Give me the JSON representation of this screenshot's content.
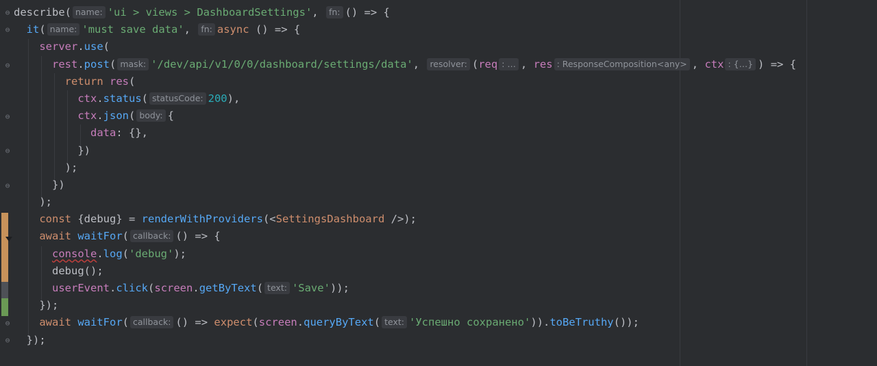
{
  "editor": {
    "lines": [
      [
        {
          "t": "describe",
          "c": ""
        },
        {
          "t": "(",
          "c": ""
        },
        {
          "h": "name:"
        },
        {
          "t": "'ui > views > DashboardSettings'",
          "c": "str"
        },
        {
          "t": ", ",
          "c": ""
        },
        {
          "h": "fn:"
        },
        {
          "t": "() => {",
          "c": ""
        }
      ],
      [
        {
          "t": "  "
        },
        {
          "t": "it",
          "c": "fn"
        },
        {
          "t": "(",
          "c": ""
        },
        {
          "h": "name:"
        },
        {
          "t": "'must save data'",
          "c": "str"
        },
        {
          "t": ", ",
          "c": ""
        },
        {
          "h": "fn:"
        },
        {
          "t": "async",
          "c": "kw"
        },
        {
          "t": " () => {",
          "c": ""
        }
      ],
      [
        {
          "t": "    "
        },
        {
          "t": "server",
          "c": "prop"
        },
        {
          "t": "."
        },
        {
          "t": "use",
          "c": "fn"
        },
        {
          "t": "("
        }
      ],
      [
        {
          "t": "      "
        },
        {
          "t": "rest",
          "c": "prop"
        },
        {
          "t": "."
        },
        {
          "t": "post",
          "c": "fn"
        },
        {
          "t": "("
        },
        {
          "h": "mask:"
        },
        {
          "t": "'/dev/api/v1/0/0/dashboard/settings/data'",
          "c": "str"
        },
        {
          "t": ", "
        },
        {
          "h": "resolver:"
        },
        {
          "t": "("
        },
        {
          "t": "req",
          "c": "prop"
        },
        {
          "h": ": …"
        },
        {
          "t": ", "
        },
        {
          "t": "res",
          "c": "prop"
        },
        {
          "h": ": ResponseComposition<any>"
        },
        {
          "t": ", "
        },
        {
          "t": "ctx",
          "c": "prop"
        },
        {
          "h": ": {…}"
        },
        {
          "t": ") => {"
        }
      ],
      [
        {
          "t": "        "
        },
        {
          "t": "return",
          "c": "kw"
        },
        {
          "t": " "
        },
        {
          "t": "res",
          "c": "prop"
        },
        {
          "t": "("
        }
      ],
      [
        {
          "t": "          "
        },
        {
          "t": "ctx",
          "c": "prop"
        },
        {
          "t": "."
        },
        {
          "t": "status",
          "c": "fn"
        },
        {
          "t": "("
        },
        {
          "h": "statusCode:"
        },
        {
          "t": "200",
          "c": "num"
        },
        {
          "t": "),"
        }
      ],
      [
        {
          "t": "          "
        },
        {
          "t": "ctx",
          "c": "prop"
        },
        {
          "t": "."
        },
        {
          "t": "json",
          "c": "fn"
        },
        {
          "t": "("
        },
        {
          "h": "body:"
        },
        {
          "t": "{"
        }
      ],
      [
        {
          "t": "            "
        },
        {
          "t": "data",
          "c": "prop"
        },
        {
          "t": ": {},"
        }
      ],
      [
        {
          "t": "          })"
        }
      ],
      [
        {
          "t": "        );"
        }
      ],
      [
        {
          "t": "      })"
        }
      ],
      [
        {
          "t": "    );"
        }
      ],
      [
        {
          "t": "    "
        },
        {
          "t": "const",
          "c": "kw"
        },
        {
          "t": " {debug} = "
        },
        {
          "t": "renderWithProviders",
          "c": "fn"
        },
        {
          "t": "(<"
        },
        {
          "t": "SettingsDashboard",
          "c": "kw"
        },
        {
          "t": " />);"
        }
      ],
      [
        {
          "t": "    "
        },
        {
          "t": "await",
          "c": "kw"
        },
        {
          "t": " "
        },
        {
          "t": "waitFor",
          "c": "fn"
        },
        {
          "t": "("
        },
        {
          "h": "callback:"
        },
        {
          "t": "() => {"
        }
      ],
      [
        {
          "t": "      "
        },
        {
          "t": "console",
          "c": "prop warn"
        },
        {
          "t": "."
        },
        {
          "t": "log",
          "c": "fn"
        },
        {
          "t": "("
        },
        {
          "t": "'debug'",
          "c": "str"
        },
        {
          "t": ");"
        }
      ],
      [
        {
          "t": "      debug();"
        }
      ],
      [
        {
          "t": "      "
        },
        {
          "t": "userEvent",
          "c": "prop"
        },
        {
          "t": "."
        },
        {
          "t": "click",
          "c": "fn"
        },
        {
          "t": "("
        },
        {
          "t": "screen",
          "c": "prop"
        },
        {
          "t": "."
        },
        {
          "t": "getByText",
          "c": "fn"
        },
        {
          "t": "("
        },
        {
          "h": "text:"
        },
        {
          "t": "'Save'",
          "c": "str"
        },
        {
          "t": "));"
        }
      ],
      [
        {
          "t": "    });"
        }
      ],
      [
        {
          "t": "    "
        },
        {
          "t": "await",
          "c": "kw"
        },
        {
          "t": " "
        },
        {
          "t": "waitFor",
          "c": "fn"
        },
        {
          "t": "("
        },
        {
          "h": "callback:"
        },
        {
          "t": "() => "
        },
        {
          "t": "expect",
          "c": "kw"
        },
        {
          "t": "("
        },
        {
          "t": "screen",
          "c": "prop"
        },
        {
          "t": "."
        },
        {
          "t": "queryByText",
          "c": "fn"
        },
        {
          "t": "("
        },
        {
          "h": "text:"
        },
        {
          "t": "'Успешно сохранено'",
          "c": "str"
        },
        {
          "t": "))."
        },
        {
          "t": "toBeTruthy",
          "c": "fn"
        },
        {
          "t": "());"
        }
      ],
      [
        {
          "t": "  });"
        }
      ]
    ]
  },
  "gutter": {
    "fold_icons": [
      "fold-open-icon",
      "fold-open-icon",
      "fold-open-icon",
      "fold-open-icon",
      "fold-close-icon",
      "fold-close-icon",
      "fold-close-icon",
      "fold-close-icon"
    ]
  },
  "colors": {
    "background": "#2b2d30",
    "keyword": "#cf8e6d",
    "function": "#56a8f5",
    "string": "#6aab73",
    "number": "#2aacb8",
    "property": "#c77dbb",
    "vcs_modified": "#c7925b",
    "vcs_added": "#6a9955"
  }
}
